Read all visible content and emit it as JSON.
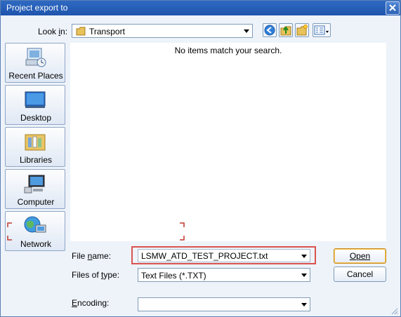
{
  "window": {
    "title": "Project export to"
  },
  "look_in": {
    "label": "Look in:",
    "value": "Transport"
  },
  "toolbar": {
    "icons": [
      "back-icon",
      "up-folder-icon",
      "new-folder-icon",
      "view-menu-icon"
    ]
  },
  "places": [
    {
      "key": "recent-places",
      "label": "Recent Places"
    },
    {
      "key": "desktop",
      "label": "Desktop"
    },
    {
      "key": "libraries",
      "label": "Libraries"
    },
    {
      "key": "computer",
      "label": "Computer"
    },
    {
      "key": "network",
      "label": "Network"
    }
  ],
  "list": {
    "empty_message": "No items match your search."
  },
  "file_name": {
    "label": "File name:",
    "value": "LSMW_ATD_TEST_PROJECT.txt"
  },
  "file_type": {
    "label": "Files of type:",
    "value": "Text Files (*.TXT)"
  },
  "encoding": {
    "label": "Encoding:",
    "value": ""
  },
  "buttons": {
    "open": "Open",
    "cancel": "Cancel"
  },
  "colors": {
    "titlebar": "#2358b0",
    "highlight_border": "#d9534f",
    "dialog_bg": "#eef3fa"
  }
}
